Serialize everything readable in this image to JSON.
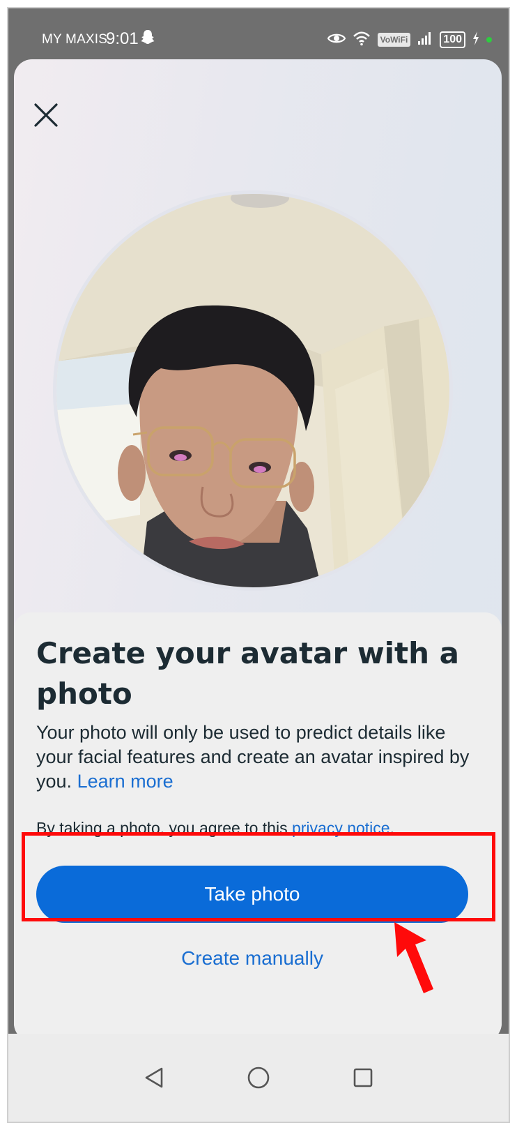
{
  "status_bar": {
    "carrier": "MY MAXIS",
    "time": "9:01",
    "vowifi": "VoWiFi",
    "battery": "100"
  },
  "header": {
    "close_icon": "close-icon"
  },
  "card": {
    "title": "Create your avatar with a photo",
    "description": "Your photo will only be used to predict details like your facial features and create an avatar inspired by you.",
    "learn_more": "Learn more",
    "consent_prefix": "By taking a photo, you agree to this",
    "privacy_link": "privacy notice",
    "consent_suffix": ".",
    "take_photo": "Take photo",
    "create_manually": "Create manually"
  },
  "colors": {
    "primary": "#0a6bd9",
    "link": "#1a6ed1",
    "text": "#1c2b33",
    "annotation": "#ff0a0a"
  },
  "nav_bar": {
    "icons": [
      "back-triangle-icon",
      "home-circle-icon",
      "recents-square-icon"
    ]
  }
}
